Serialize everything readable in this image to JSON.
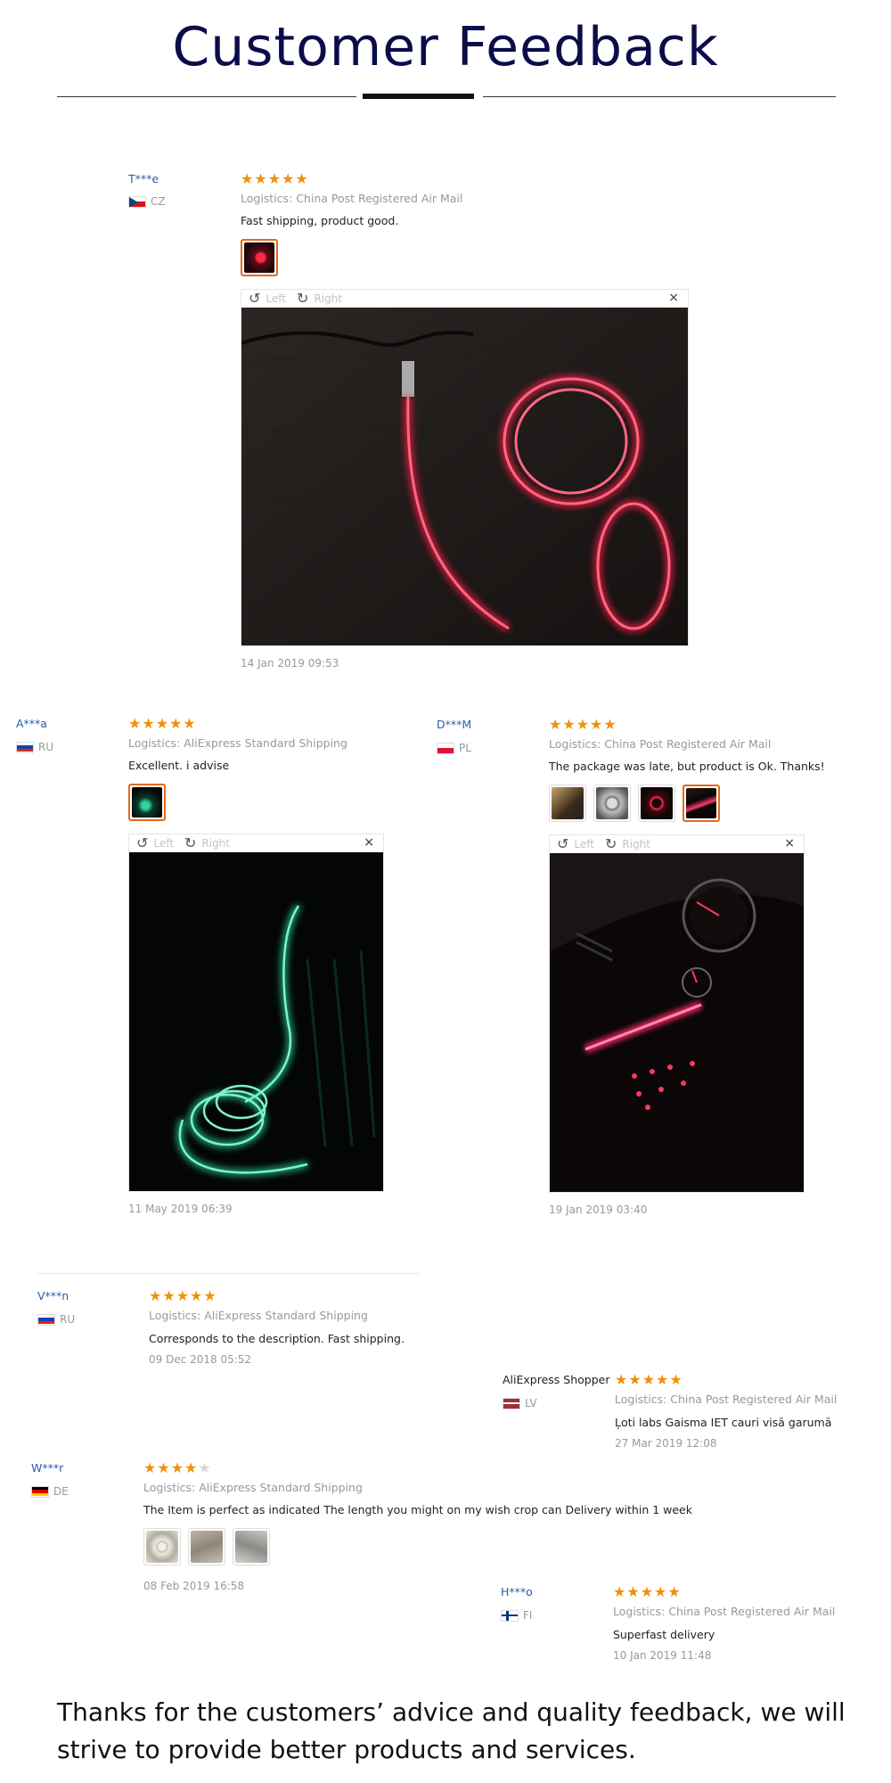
{
  "header": {
    "title": "Customer Feedback"
  },
  "viewer_controls": {
    "left": "Left",
    "right": "Right",
    "close": "×"
  },
  "reviews": [
    {
      "user": "T***e",
      "country": "CZ",
      "rating": 5,
      "logistics": "Logistics: China Post Registered Air Mail",
      "comment": "Fast shipping, product good.",
      "date": "14 Jan 2019 09:53",
      "photos": [
        "red-glow-fiber-thumb"
      ],
      "active_photo": 0
    },
    {
      "user": "A***a",
      "country": "RU",
      "rating": 5,
      "logistics": "Logistics: AliExpress Standard Shipping",
      "comment": "Excellent. i advise",
      "date": "11 May 2019 06:39",
      "photos": [
        "green-glow-fiber-thumb"
      ],
      "active_photo": 0
    },
    {
      "user": "D***M",
      "country": "PL",
      "rating": 5,
      "logistics": "Logistics: China Post Registered Air Mail",
      "comment": "The package was late, but product is Ok. Thanks!",
      "date": "19 Jan 2019 03:40",
      "photos": [
        "package-thumb",
        "roll-thumb",
        "red-loop-thumb",
        "car-dash-thumb"
      ],
      "active_photo": 3
    },
    {
      "user": "V***n",
      "country": "RU",
      "rating": 5,
      "logistics": "Logistics: AliExpress Standard Shipping",
      "comment": "Corresponds to the description. Fast shipping.",
      "date": "09 Dec 2018 05:52",
      "photos": []
    },
    {
      "user": "AliExpress Shopper",
      "country": "LV",
      "rating": 5,
      "logistics": "Logistics: China Post Registered Air Mail",
      "comment": "Ļoti labs Gaisma IET cauri visā garumā",
      "date": "27 Mar 2019 12:08",
      "photos": []
    },
    {
      "user": "W***r",
      "country": "DE",
      "rating": 4,
      "logistics": "Logistics: AliExpress Standard Shipping",
      "comment": "The Item is perfect as indicated The length you might on my wish crop can Delivery within 1 week",
      "date": "08 Feb 2019 16:58",
      "photos": [
        "coil-thumb",
        "grey-thumb-1",
        "grey-thumb-2"
      ]
    },
    {
      "user": "H***o",
      "country": "FI",
      "rating": 5,
      "logistics": "Logistics: China Post Registered Air Mail",
      "comment": "Superfast delivery",
      "date": "10 Jan 2019 11:48",
      "photos": []
    }
  ],
  "footer": {
    "text": "Thanks for the customers’ advice and quality feedback, we will strive to provide better products and services."
  },
  "colors": {
    "title": "#0c0c4a",
    "username": "#2a5caa",
    "star": "#f0900a",
    "active_thumb_border": "#e26a1a",
    "muted": "#999999"
  }
}
